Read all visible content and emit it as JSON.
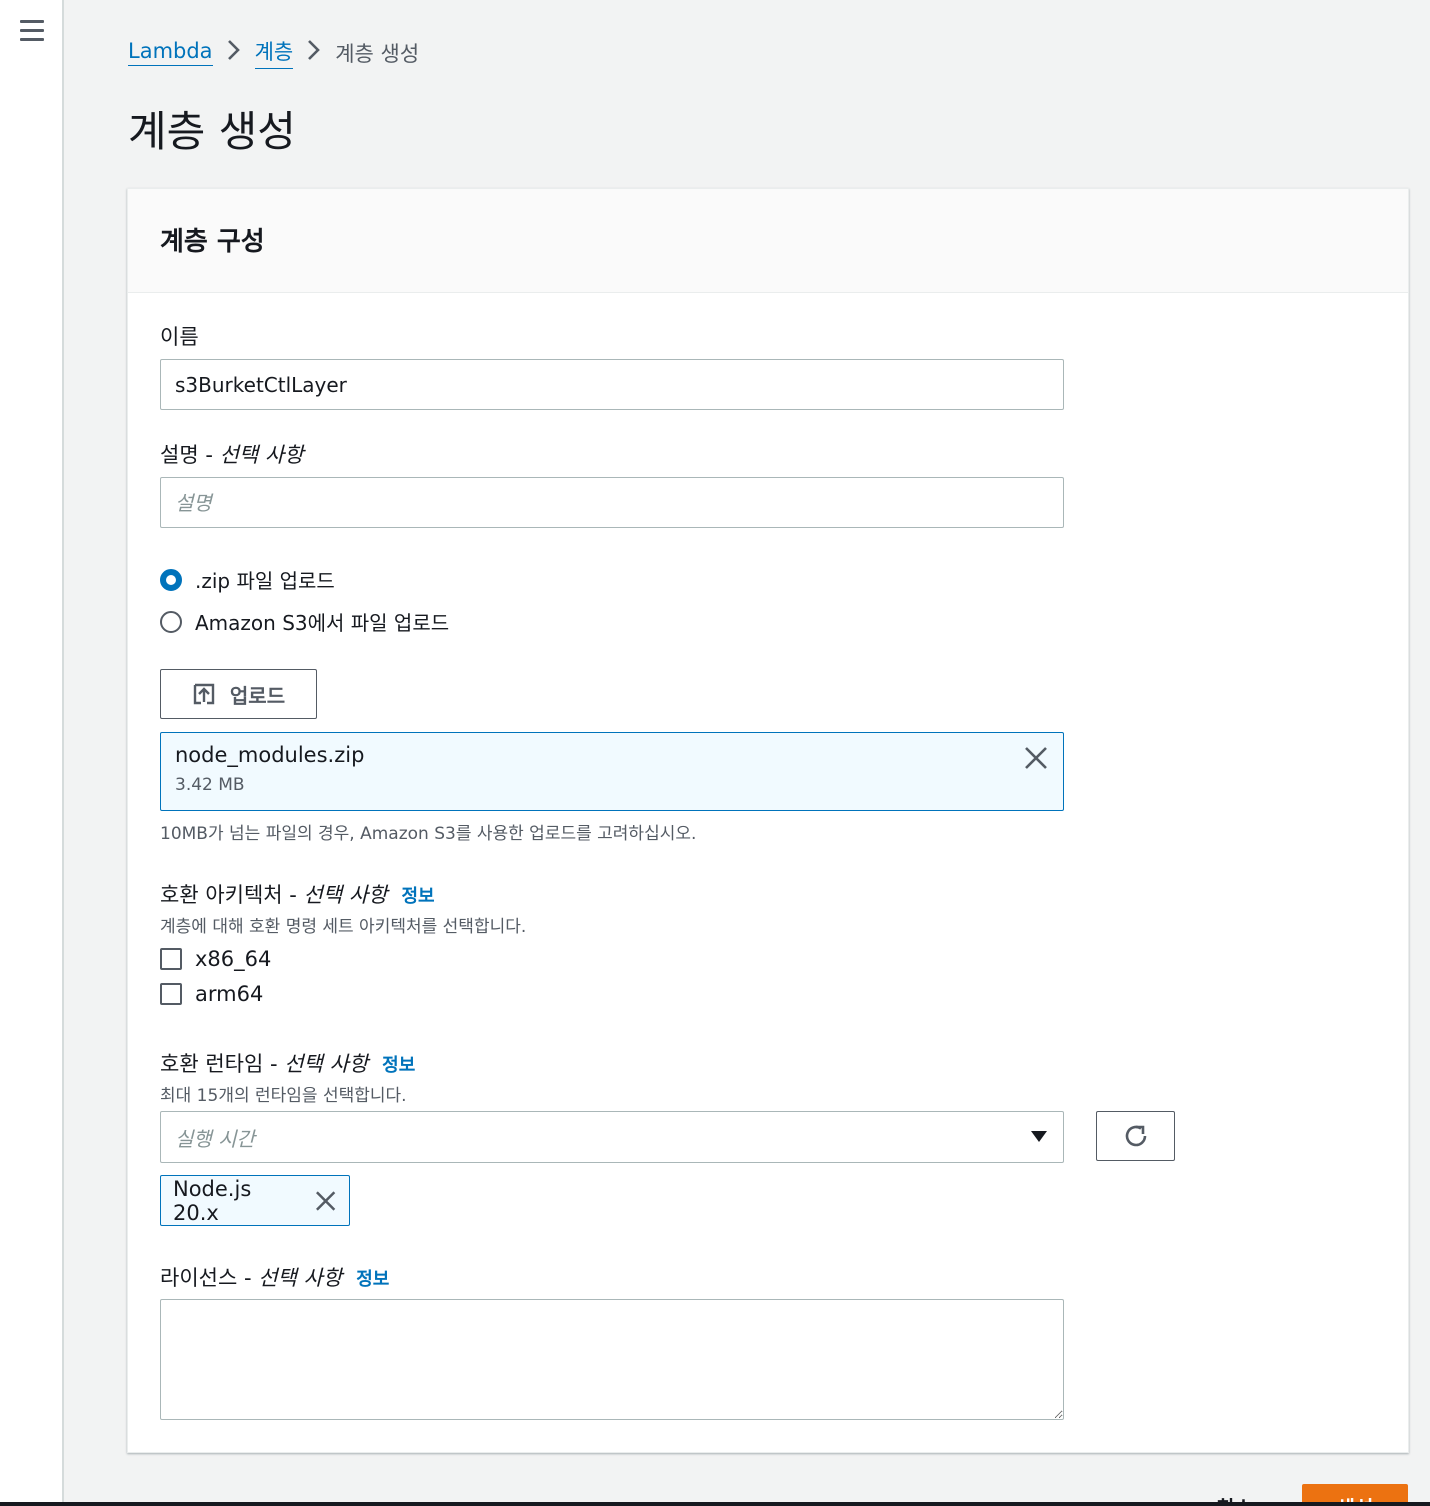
{
  "breadcrumb": {
    "items": [
      "Lambda",
      "계층"
    ],
    "current": "계층 생성"
  },
  "page": {
    "title": "계층 생성"
  },
  "panel": {
    "title": "계층 구성",
    "name": {
      "label": "이름",
      "value": "s3BurketCtlLayer"
    },
    "description": {
      "label": "설명 - ",
      "optional": "선택 사항",
      "placeholder": "설명"
    },
    "upload_options": [
      {
        "label": ".zip 파일 업로드",
        "selected": true
      },
      {
        "label": "Amazon S3에서 파일 업로드",
        "selected": false
      }
    ],
    "upload_button": "업로드",
    "file": {
      "name": "node_modules.zip",
      "size": "3.42 MB"
    },
    "file_hint": "10MB가 넘는 파일의 경우, Amazon S3를 사용한 업로드를 고려하십시오.",
    "architecture": {
      "label": "호환 아키텍처 - ",
      "optional": "선택 사항",
      "info": "정보",
      "description": "계층에 대해 호환 명령 세트 아키텍처를 선택합니다.",
      "options": [
        {
          "label": "x86_64",
          "checked": false
        },
        {
          "label": "arm64",
          "checked": false
        }
      ]
    },
    "runtime": {
      "label": "호환 런타임 - ",
      "optional": "선택 사항",
      "info": "정보",
      "description": "최대 15개의 런타임을 선택합니다.",
      "placeholder": "실행 시간",
      "selected": [
        "Node.js 20.x"
      ]
    },
    "license": {
      "label": "라이선스 - ",
      "optional": "선택 사항",
      "info": "정보",
      "value": ""
    }
  },
  "footer": {
    "cancel": "취소",
    "create": "생성"
  },
  "colors": {
    "accent": "#0073bb",
    "primary_button": "#ec7211"
  },
  "icons": [
    "menu-icon",
    "chevron-right-icon",
    "upload-icon",
    "close-icon",
    "refresh-icon",
    "caret-down-icon"
  ]
}
